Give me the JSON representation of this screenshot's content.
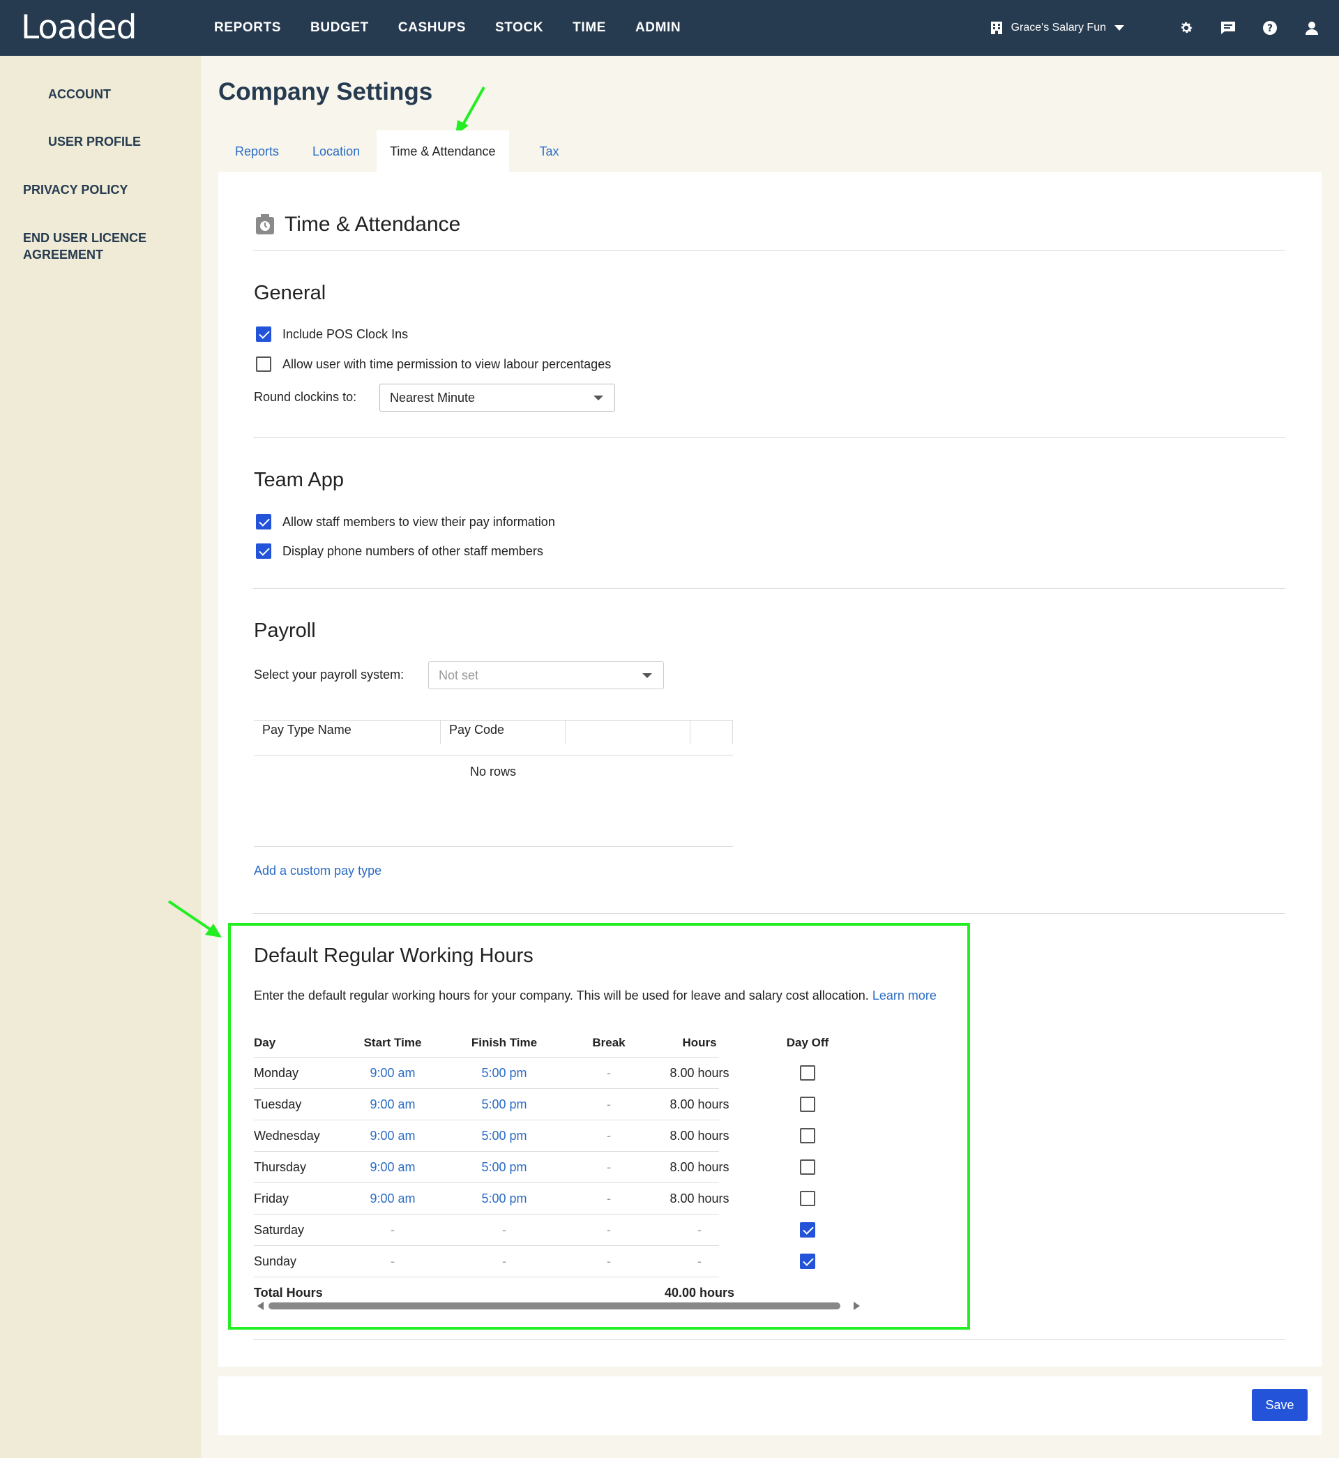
{
  "app": {
    "logo": "Loaded"
  },
  "nav": {
    "items": [
      "REPORTS",
      "BUDGET",
      "CASHUPS",
      "STOCK",
      "TIME",
      "ADMIN"
    ],
    "company": "Grace's Salary Fun"
  },
  "sidebar": {
    "items": [
      "ACCOUNT",
      "USER PROFILE",
      "PRIVACY POLICY",
      "END USER LICENCE",
      "AGREEMENT"
    ]
  },
  "page": {
    "title": "Company Settings",
    "tabs": [
      "Reports",
      "Location",
      "Time & Attendance",
      "Tax"
    ],
    "active_tab": "Time & Attendance"
  },
  "section_title": "Time & Attendance",
  "general": {
    "heading": "General",
    "include_pos": {
      "label": "Include POS Clock Ins",
      "checked": true
    },
    "labour_pct": {
      "label": "Allow user with time permission to view labour percentages",
      "checked": false
    },
    "round_label": "Round clockins to:",
    "round_value": "Nearest Minute"
  },
  "team_app": {
    "heading": "Team App",
    "pay_info": {
      "label": "Allow staff members to view their pay information",
      "checked": true
    },
    "phones": {
      "label": "Display phone numbers of other staff members",
      "checked": true
    }
  },
  "payroll": {
    "heading": "Payroll",
    "system_label": "Select your payroll system:",
    "system_placeholder": "Not set",
    "columns": [
      "Pay Type Name",
      "Pay Code"
    ],
    "empty": "No rows",
    "add_link": "Add a custom pay type"
  },
  "working_hours": {
    "heading": "Default Regular Working Hours",
    "description": "Enter the default regular working hours for your company. This will be used for leave and salary cost allocation.",
    "learn_more": "Learn more",
    "columns": [
      "Day",
      "Start Time",
      "Finish Time",
      "Break",
      "Hours",
      "Day Off"
    ],
    "rows": [
      {
        "day": "Monday",
        "start": "9:00 am",
        "finish": "5:00 pm",
        "break": "-",
        "hours": "8.00 hours",
        "off": false
      },
      {
        "day": "Tuesday",
        "start": "9:00 am",
        "finish": "5:00 pm",
        "break": "-",
        "hours": "8.00 hours",
        "off": false
      },
      {
        "day": "Wednesday",
        "start": "9:00 am",
        "finish": "5:00 pm",
        "break": "-",
        "hours": "8.00 hours",
        "off": false
      },
      {
        "day": "Thursday",
        "start": "9:00 am",
        "finish": "5:00 pm",
        "break": "-",
        "hours": "8.00 hours",
        "off": false
      },
      {
        "day": "Friday",
        "start": "9:00 am",
        "finish": "5:00 pm",
        "break": "-",
        "hours": "8.00 hours",
        "off": false
      },
      {
        "day": "Saturday",
        "start": "-",
        "finish": "-",
        "break": "-",
        "hours": "-",
        "off": true
      },
      {
        "day": "Sunday",
        "start": "-",
        "finish": "-",
        "break": "-",
        "hours": "-",
        "off": true
      }
    ],
    "total_label": "Total Hours",
    "total_value": "40.00 hours"
  },
  "save_label": "Save",
  "colors": {
    "nav_bg": "#263a50",
    "accent": "#2253d8",
    "link": "#2b6cc4",
    "highlight": "#22ee22",
    "sidebar_bg": "#efebd6"
  }
}
